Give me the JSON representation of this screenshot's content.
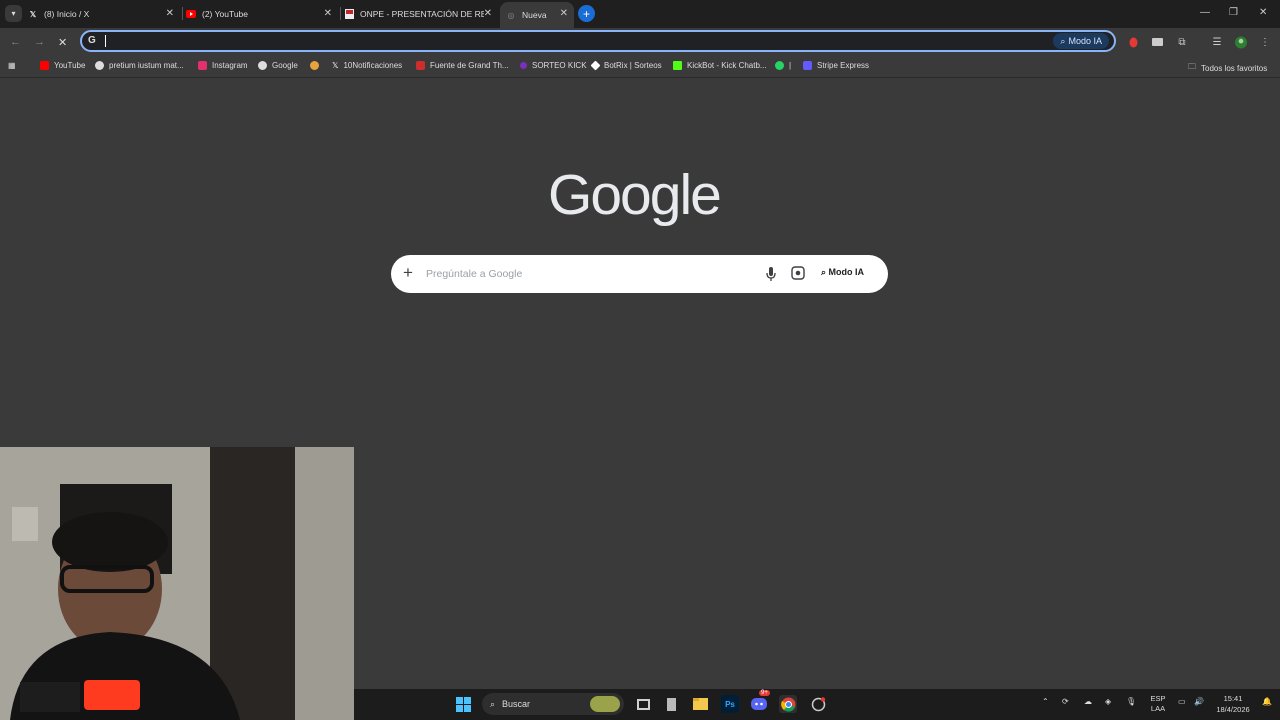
{
  "tabs": [
    {
      "title": "(8) Inicio / X",
      "icon": "x-logo-icon"
    },
    {
      "title": "(2) YouTube",
      "icon": "youtube-icon"
    },
    {
      "title": "ONPE - PRESENTACIÓN DE RE",
      "icon": "onpe-icon"
    },
    {
      "title": "Nueva",
      "icon": "chrome-tab-icon"
    }
  ],
  "omnibox": {
    "value": "",
    "modo_ia_label": "Modo IA"
  },
  "bookmarks": [
    {
      "label": "YouTube",
      "color": "#ff0000"
    },
    {
      "label": "pretium iustum mat...",
      "color": "#dddddd"
    },
    {
      "label": "Instagram",
      "color": "#e1306c"
    },
    {
      "label": "Google",
      "color": "#dddddd"
    },
    {
      "label": "",
      "color": "#e8a33c"
    },
    {
      "label": "10Notificaciones",
      "color": "#ffffff"
    },
    {
      "label": "Fuente de Grand Th...",
      "color": "#cc2e2e"
    },
    {
      "label": "SORTEO KICK",
      "color": "#7b2fbf"
    },
    {
      "label": "BotRix | Sorteos",
      "color": "#ffffff"
    },
    {
      "label": "KickBot - Kick Chatb...",
      "color": "#53fc18"
    },
    {
      "label": "|",
      "color": "#25d366"
    },
    {
      "label": "Stripe Express",
      "color": "#635bff"
    }
  ],
  "all_bookmarks_label": "Todos los favoritos",
  "google": {
    "logo": "Google",
    "search_placeholder": "Pregúntale a Google",
    "modo_ia_label": "Modo IA"
  },
  "taskbar": {
    "search_label": "Buscar",
    "language": "ESP",
    "language_sub": "LAA",
    "time": "15:41",
    "date": "18/4/2026",
    "discord_badge": "9+"
  },
  "colors": {
    "accent": "#8ab4f8",
    "page_bg": "#3a3a3a",
    "tabstrip_bg": "#1f1f1f"
  }
}
